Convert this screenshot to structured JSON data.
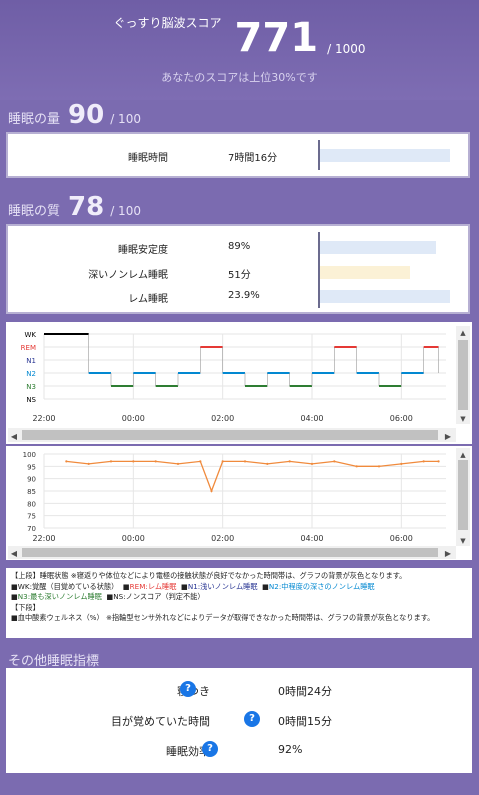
{
  "score": {
    "label": "ぐっすり脳波スコア",
    "value": "771",
    "max": "/ 1000",
    "subtitle": "あなたのスコアは上位30%です"
  },
  "quantity": {
    "title": "睡眠の量",
    "value": "90",
    "max": "/ 100",
    "rows": [
      {
        "label": "睡眠時間",
        "value": "7時間16分",
        "fraction": 0.93,
        "color": "#dfe9f7"
      }
    ]
  },
  "quality": {
    "title": "睡眠の質",
    "value": "78",
    "max": "/ 100",
    "rows": [
      {
        "label": "睡眠安定度",
        "value": "89%",
        "fraction": 0.83,
        "color": "#dfe9f7"
      },
      {
        "label": "深いノンレム睡眠",
        "value": "51分",
        "fraction": 0.64,
        "color": "#fbf1d6"
      },
      {
        "label": "レム睡眠",
        "value": "23.9%",
        "fraction": 0.93,
        "color": "#dfe9f7"
      }
    ]
  },
  "chart_data": [
    {
      "type": "line",
      "stages": [
        "WK",
        "REM",
        "N1",
        "N2",
        "N3",
        "NS"
      ],
      "stage_colors": [
        "#000000",
        "#e53935",
        "#283593",
        "#0288d1",
        "#2e7d32",
        "#000000"
      ],
      "xticks": [
        "22:00",
        "00:00",
        "02:00",
        "04:00",
        "06:00"
      ],
      "x": [
        "22:00",
        "23:00",
        "23:30",
        "00:00",
        "00:30",
        "01:00",
        "01:30",
        "02:00",
        "02:30",
        "03:00",
        "03:30",
        "04:00",
        "04:30",
        "05:00",
        "05:30",
        "06:00",
        "06:30",
        "06:50"
      ],
      "stage": [
        "WK",
        "N2",
        "N3",
        "N2",
        "N3",
        "N2",
        "REM",
        "N2",
        "N3",
        "N2",
        "N3",
        "N2",
        "REM",
        "N2",
        "N3",
        "N2",
        "REM",
        "N2"
      ]
    },
    {
      "type": "line",
      "ylabel_ticks": [
        "100",
        "95",
        "90",
        "85",
        "80",
        "75",
        "70"
      ],
      "ylim": [
        70,
        100
      ],
      "xticks": [
        "22:00",
        "00:00",
        "02:00",
        "04:00",
        "06:00"
      ],
      "x": [
        "22:30",
        "23:00",
        "23:30",
        "00:00",
        "00:30",
        "01:00",
        "01:30",
        "01:45",
        "02:00",
        "02:30",
        "03:00",
        "03:30",
        "04:00",
        "04:30",
        "05:00",
        "05:30",
        "06:00",
        "06:30",
        "06:50"
      ],
      "values": [
        97,
        96,
        97,
        97,
        97,
        96,
        97,
        85,
        97,
        97,
        96,
        97,
        96,
        97,
        95,
        95,
        96,
        97,
        97
      ],
      "color": "#f08a3c"
    }
  ],
  "legend": {
    "line1": "【上段】睡眠状態 ※寝返りや体位などにより電極の接触状態が良好でなかった時間帯は、グラフの背景が灰色となります。",
    "items": [
      {
        "text": "WK:覚醒（目覚めている状態）",
        "color": "#222222"
      },
      {
        "text": "REM:レム睡眠",
        "color": "#e53935"
      },
      {
        "text": "N1:浅いノンレム睡眠",
        "color": "#283593"
      },
      {
        "text": "N2:中程度の深さのノンレム睡眠",
        "color": "#0288d1"
      },
      {
        "text": "N3:最も深いノンレム睡眠",
        "color": "#2e7d32"
      },
      {
        "text": "NS:ノンスコア（判定不能）",
        "color": "#222222"
      }
    ],
    "line_lower": "【下段】",
    "line_spo2": "血中酸素ウェルネス（%） ※指輪型センサ外れなどによりデータが取得できなかった時間帯は、グラフの背景が灰色となります。"
  },
  "other": {
    "title": "その他睡眠指標",
    "rows": [
      {
        "label": "寝つき",
        "help": "?",
        "value": "0時間24分"
      },
      {
        "label": "目が覚めていた時間",
        "help": "?",
        "value": "0時間15分"
      },
      {
        "label": "睡眠効率",
        "help": "?",
        "value": "92%"
      }
    ]
  }
}
